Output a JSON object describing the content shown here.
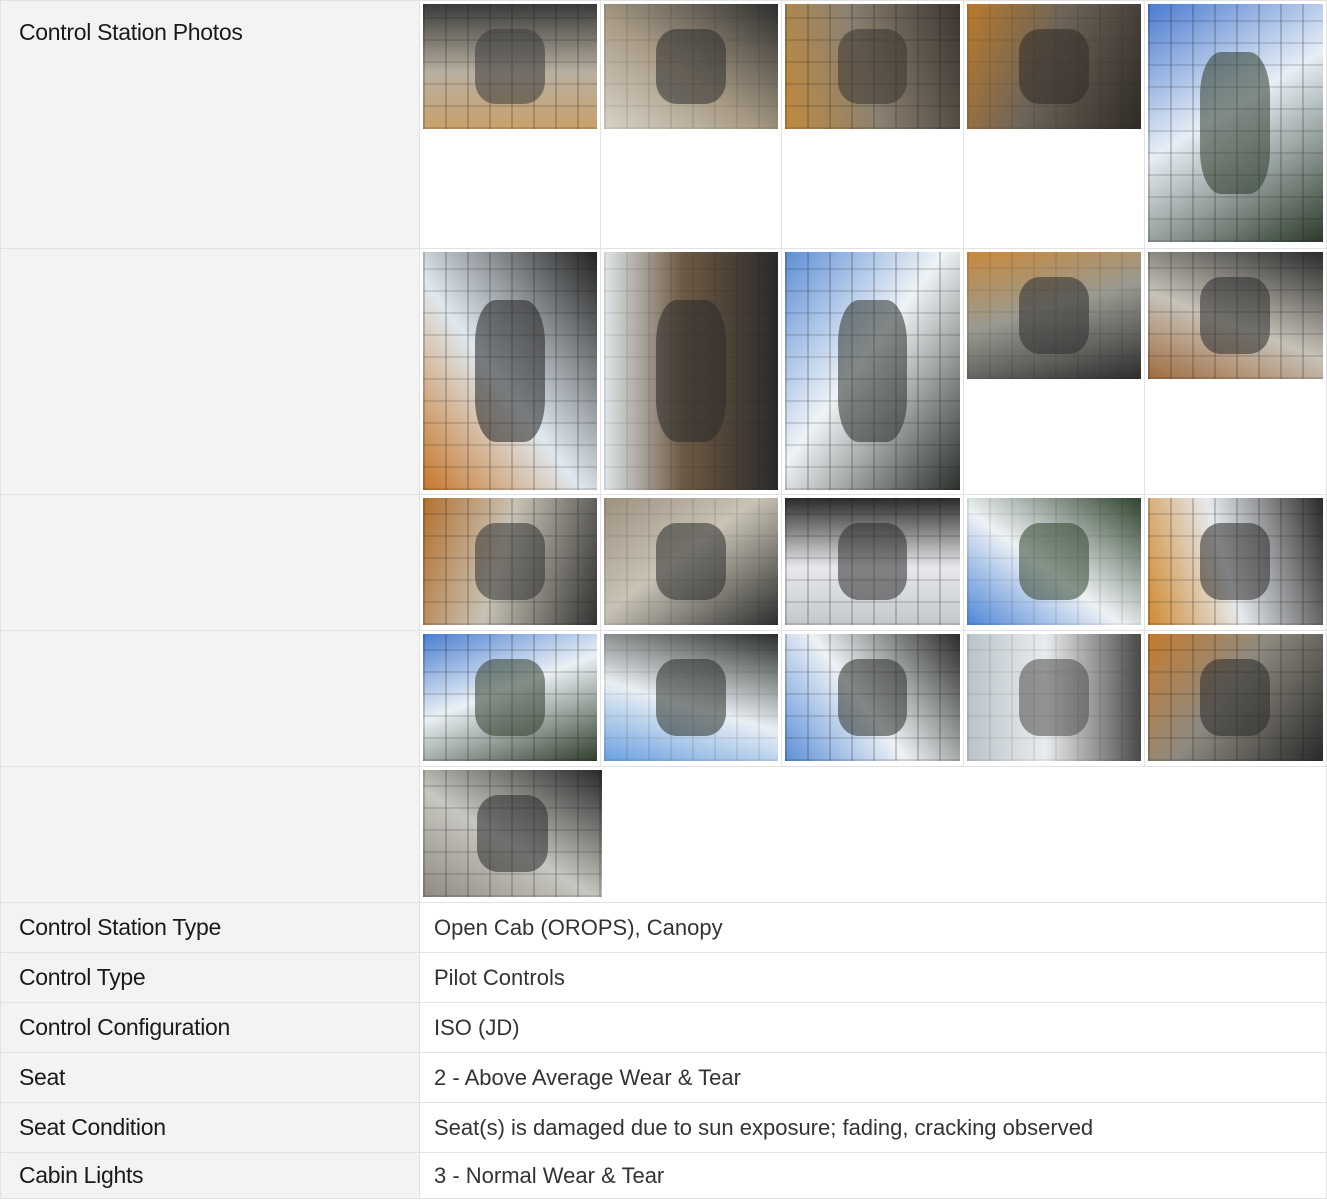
{
  "photos_section": {
    "label": "Control Station Photos",
    "rows": [
      {
        "cells": [
          {
            "name": "seat-photo-1",
            "h": 125,
            "c1": "#c9a06a",
            "c2": "#3a3a3a",
            "c3": "#b8b0a0"
          },
          {
            "name": "seat-photo-2",
            "h": 125,
            "c1": "#d7d2c6",
            "c2": "#2e2e2e",
            "c3": "#a89b86"
          },
          {
            "name": "console-photo-1",
            "h": 125,
            "c1": "#c08a3c",
            "c2": "#3b3530",
            "c3": "#8d8272"
          },
          {
            "name": "console-photo-2",
            "h": 125,
            "c1": "#b97a2c",
            "c2": "#2f2a25",
            "c3": "#6d6459"
          },
          {
            "name": "cab-window-photo-1",
            "h": 238,
            "c1": "#4a7bd0",
            "c2": "#2c3a2a",
            "c3": "#e7eef5"
          }
        ]
      },
      {
        "cells": [
          {
            "name": "joystick-photo-1",
            "h": 238,
            "c1": "#c8772a",
            "c2": "#222222",
            "c3": "#dfe8ef"
          },
          {
            "name": "joystick-photo-2",
            "h": 238,
            "c1": "#dfe6ea",
            "c2": "#2a2a2a",
            "c3": "#6e5a44"
          },
          {
            "name": "panel-photo-1",
            "h": 238,
            "c1": "#5d8ed6",
            "c2": "#2a2f2a",
            "c3": "#eef3f6"
          },
          {
            "name": "pedals-photo",
            "h": 127,
            "c1": "#c88a3c",
            "c2": "#2d2d2d",
            "c3": "#9a9a92"
          },
          {
            "name": "lever-photo",
            "h": 127,
            "c1": "#a06c40",
            "c2": "#2b2b2b",
            "c3": "#c7c2b8"
          }
        ]
      },
      {
        "cells": [
          {
            "name": "floor-lever-photo-1",
            "h": 127,
            "c1": "#b3712e",
            "c2": "#333333",
            "c3": "#c8c2b5"
          },
          {
            "name": "floor-lever-photo-2",
            "h": 127,
            "c1": "#9d9180",
            "c2": "#2e2e2e",
            "c3": "#c9c3b6"
          },
          {
            "name": "side-console-photo",
            "h": 127,
            "c1": "#c3c7cc",
            "c2": "#2b2b2b",
            "c3": "#e7e9ec"
          },
          {
            "name": "cab-window-photo-2",
            "h": 127,
            "c1": "#4e86d8",
            "c2": "#30442e",
            "c3": "#eef2f5"
          },
          {
            "name": "side-frame-photo",
            "h": 127,
            "c1": "#d08a30",
            "c2": "#2a2a2a",
            "c3": "#e6eaee"
          }
        ]
      },
      {
        "cells": [
          {
            "name": "cab-window-photo-3",
            "h": 127,
            "c1": "#4a7ed2",
            "c2": "#2f3e2c",
            "c3": "#eaf0f4"
          },
          {
            "name": "panel-photo-2",
            "h": 127,
            "c1": "#6aa0e0",
            "c2": "#2a2f2a",
            "c3": "#e9eff3"
          },
          {
            "name": "panel-photo-3",
            "h": 127,
            "c1": "#5b8fd8",
            "c2": "#2a2d2a",
            "c3": "#eef2f5"
          },
          {
            "name": "ignition-photo",
            "h": 127,
            "c1": "#b9c3c9",
            "c2": "#4a4a48",
            "c3": "#e9ecee"
          },
          {
            "name": "switch-photo",
            "h": 127,
            "c1": "#c57b2d",
            "c2": "#2a2a2a",
            "c3": "#8f8a80"
          }
        ]
      },
      {
        "cells": [
          {
            "name": "handle-photo",
            "h": 127,
            "c1": "#8f8b84",
            "c2": "#2a2a2a",
            "c3": "#c8c6c0"
          }
        ]
      }
    ]
  },
  "details": [
    {
      "key": "control-station-type",
      "label": "Control Station Type",
      "value": "Open Cab (OROPS), Canopy"
    },
    {
      "key": "control-type",
      "label": "Control Type",
      "value": "Pilot Controls"
    },
    {
      "key": "control-configuration",
      "label": "Control Configuration",
      "value": "ISO (JD)"
    },
    {
      "key": "seat",
      "label": "Seat",
      "value": "2 - Above Average Wear & Tear"
    },
    {
      "key": "seat-condition",
      "label": "Seat Condition",
      "value": "Seat(s) is damaged due to sun exposure; fading, cracking observed"
    },
    {
      "key": "cabin-lights",
      "label": "Cabin Lights",
      "value": "3 - Normal Wear & Tear"
    }
  ]
}
